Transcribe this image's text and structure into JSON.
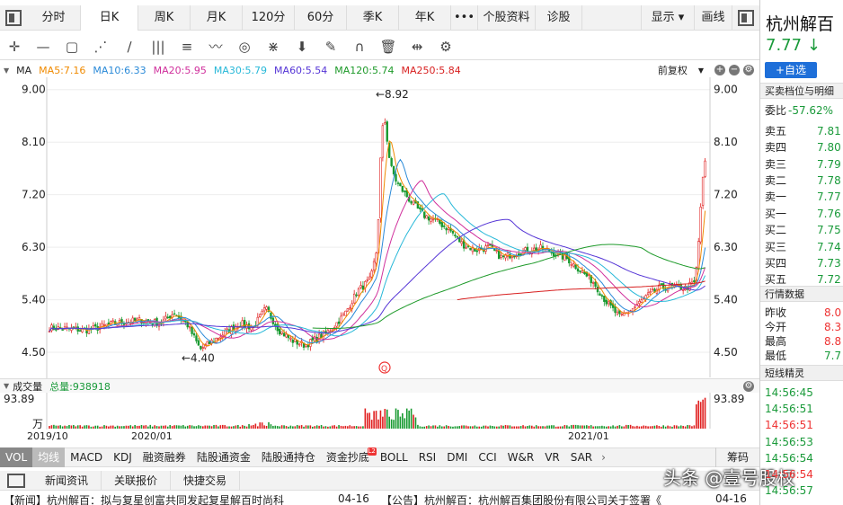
{
  "tabs": [
    "分时",
    "日K",
    "周K",
    "月K",
    "120分",
    "60分",
    "季K",
    "年K",
    "•••",
    "个股资料",
    "诊股"
  ],
  "active_tab": "日K",
  "tabs_right": {
    "display": "显示",
    "draw": "画线"
  },
  "toolbar_icons": [
    "crosshair-icon",
    "line-icon",
    "rect-icon",
    "fan-icon",
    "segment-icon",
    "parallel-icon",
    "fib-icon",
    "wave-icon",
    "cycle-icon",
    "gann-icon",
    "arrow-down-icon",
    "pen-icon",
    "magnet-icon",
    "trash-icon",
    "fit-icon",
    "settings-icon"
  ],
  "ma_bar": {
    "label": "MA",
    "items": [
      {
        "text": "MA5:7.16",
        "color": "#f08a00"
      },
      {
        "text": "MA10:6.33",
        "color": "#2a8ad8"
      },
      {
        "text": "MA20:5.95",
        "color": "#d0309c"
      },
      {
        "text": "MA30:5.79",
        "color": "#27b8d8"
      },
      {
        "text": "MA60:5.54",
        "color": "#5535d6"
      },
      {
        "text": "MA120:5.74",
        "color": "#1e9a2a"
      },
      {
        "text": "MA250:5.84",
        "color": "#d82020"
      }
    ],
    "adjust": "前复权"
  },
  "chart": {
    "price_ticks": [
      "9.00",
      "8.10",
      "7.20",
      "6.30",
      "5.40",
      "4.50"
    ],
    "high_label": "←8.92",
    "low_label": "←4.40",
    "q_marker": "Q",
    "vol_ticks": [
      "93.89",
      "万"
    ]
  },
  "volume_bar": {
    "label": "成交量",
    "total": "总量:938918"
  },
  "dates": [
    "2019/10",
    "2020/01",
    "2021/01"
  ],
  "indicator_tabs": [
    "VOL",
    "均线",
    "MACD",
    "KDJ",
    "融资融券",
    "陆股通资金",
    "陆股通持仓",
    "资金抄底",
    "BOLL",
    "RSI",
    "DMI",
    "CCI",
    "W&R",
    "VR",
    "SAR"
  ],
  "indicator_badge": "L2",
  "indicator_right": "筹码",
  "news_tabs": [
    "新闻资讯",
    "关联报价",
    "快捷交易"
  ],
  "news_items": [
    {
      "text": "【新闻】杭州解百：拟与复星创富共同发起复星解百时尚科",
      "date": "04-16"
    },
    {
      "text": "【公告】杭州解百：杭州解百集团股份有限公司关于签署《",
      "date": "04-16"
    }
  ],
  "watermark": "头条 @壹号股权",
  "stock": {
    "name": "杭州解百",
    "price": "7.77",
    "arrow": "↓",
    "add_watchlist": "+自选"
  },
  "orderbook_title": "买卖档位与明细",
  "weibi": {
    "label": "委比",
    "value": "-57.62%"
  },
  "asks": [
    {
      "label": "卖五",
      "price": "7.81"
    },
    {
      "label": "卖四",
      "price": "7.80"
    },
    {
      "label": "卖三",
      "price": "7.79"
    },
    {
      "label": "卖二",
      "price": "7.78"
    },
    {
      "label": "卖一",
      "price": "7.77"
    }
  ],
  "bids": [
    {
      "label": "买一",
      "price": "7.76"
    },
    {
      "label": "买二",
      "price": "7.75"
    },
    {
      "label": "买三",
      "price": "7.74"
    },
    {
      "label": "买四",
      "price": "7.73"
    },
    {
      "label": "买五",
      "price": "7.72"
    }
  ],
  "quote_title": "行情数据",
  "quote": [
    {
      "label": "昨收",
      "value": "8.0"
    },
    {
      "label": "今开",
      "value": "8.3"
    },
    {
      "label": "最高",
      "value": "8.8"
    },
    {
      "label": "最低",
      "value": "7.7"
    }
  ],
  "short_title": "短线精灵",
  "short_times": [
    {
      "time": "14:56:45",
      "color": "#1a9a3a"
    },
    {
      "time": "14:56:51",
      "color": "#1a9a3a"
    },
    {
      "time": "14:56:51",
      "color": "#e33"
    },
    {
      "time": "14:56:53",
      "color": "#1a9a3a"
    },
    {
      "time": "14:56:54",
      "color": "#1a9a3a"
    },
    {
      "time": "14:56:54",
      "color": "#e33"
    },
    {
      "time": "14:56:57",
      "color": "#1a9a3a"
    }
  ]
}
